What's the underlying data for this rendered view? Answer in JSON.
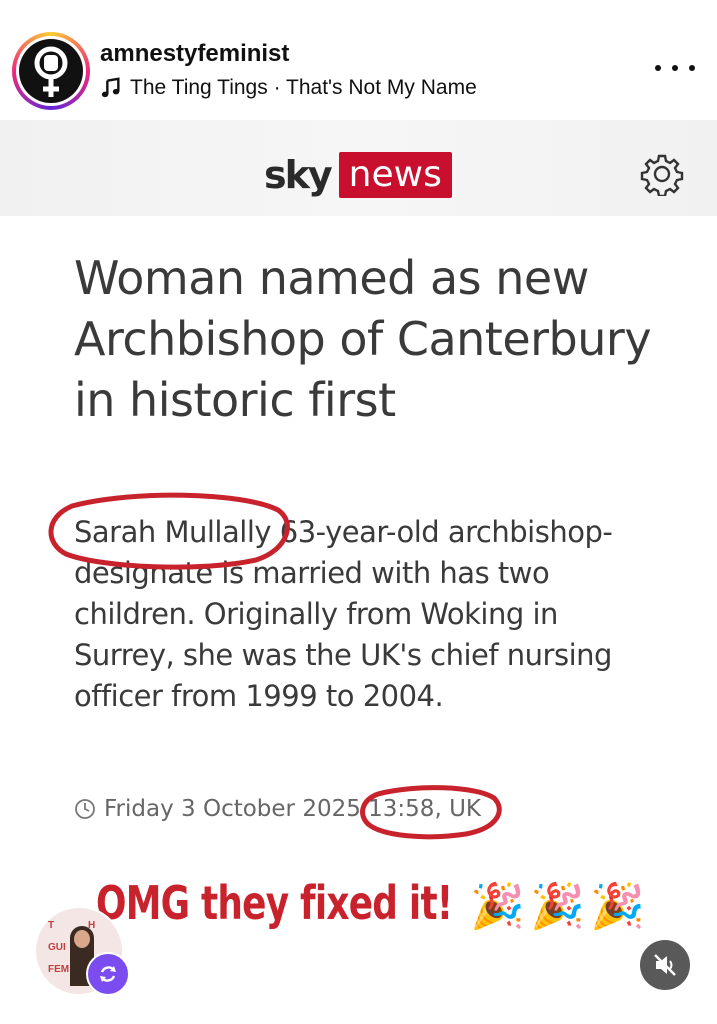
{
  "post": {
    "username": "amnestyfeminist",
    "music": "The Ting Tings · That's Not My Name"
  },
  "sky": {
    "brand_word": "sky",
    "brand_box": "news"
  },
  "article": {
    "headline": "Woman named as new Archbishop of Canterbury in historic first",
    "body": "Sarah Mullally 63-year-old archbishop-designate is married with has two children. Originally from Woking in Surrey, she was the UK's chief nursing officer from 1999 to 2004.",
    "timestamp": "Friday 3 October 2025 13:58, UK"
  },
  "caption": {
    "text": "OMG they fixed it!",
    "emoji": "🎉"
  },
  "collab_avatar_text": [
    "T",
    "H",
    "GUI",
    "FEM"
  ],
  "colors": {
    "sky_red": "#c8102e",
    "annotation_red": "#c8232c",
    "collab_badge": "#7b4df0"
  },
  "icons": [
    "music-note-icon",
    "more-options-icon",
    "gear-icon",
    "clock-icon",
    "repost-icon",
    "muted-speaker-icon",
    "feminist-fist-icon"
  ]
}
